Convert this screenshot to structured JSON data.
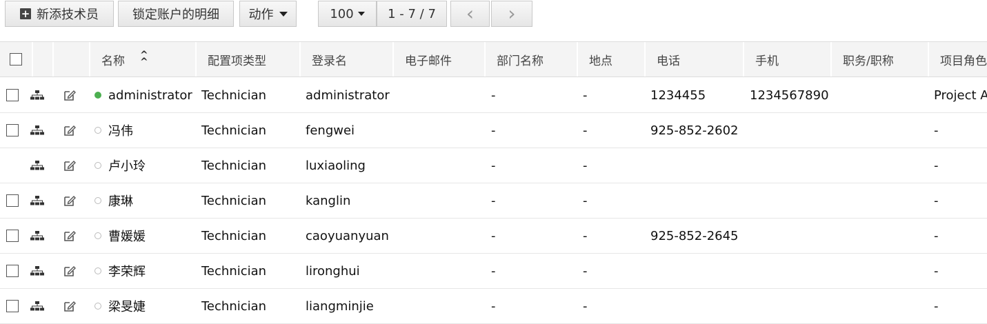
{
  "toolbar": {
    "add_technician": "新添技术员",
    "locked_accounts": "锁定账户的明细",
    "actions": "动作",
    "page_size": "100",
    "range": "1 - 7 / 7",
    "prev_icon": "chevron-left-icon",
    "next_icon": "chevron-right-icon"
  },
  "table": {
    "columns": [
      "名称",
      "配置项类型",
      "登录名",
      "电子邮件",
      "部门名称",
      "地点",
      "电话",
      "手机",
      "职务/职称",
      "项目角色"
    ],
    "rows": [
      {
        "status": "active",
        "has_checkbox": true,
        "name": "administrator",
        "type": "Technician",
        "login": "administrator",
        "email": "",
        "dept": "-",
        "site": "-",
        "phone": "1234455",
        "mobile": "1234567890",
        "title": "",
        "role": "Project A"
      },
      {
        "status": "inactive",
        "has_checkbox": true,
        "name": "冯伟",
        "type": "Technician",
        "login": "fengwei",
        "email": "",
        "dept": "-",
        "site": "-",
        "phone": "925-852-2602",
        "mobile": "",
        "title": "",
        "role": "-"
      },
      {
        "status": "inactive",
        "has_checkbox": false,
        "name": "卢小玲",
        "type": "Technician",
        "login": "luxiaoling",
        "email": "",
        "dept": "-",
        "site": "-",
        "phone": "",
        "mobile": "",
        "title": "",
        "role": "-"
      },
      {
        "status": "inactive",
        "has_checkbox": true,
        "name": "康琳",
        "type": "Technician",
        "login": "kanglin",
        "email": "",
        "dept": "-",
        "site": "-",
        "phone": "",
        "mobile": "",
        "title": "",
        "role": "-"
      },
      {
        "status": "inactive",
        "has_checkbox": true,
        "name": "曹媛媛",
        "type": "Technician",
        "login": "caoyuanyuan",
        "email": "",
        "dept": "-",
        "site": "-",
        "phone": "925-852-2645",
        "mobile": "",
        "title": "",
        "role": "-"
      },
      {
        "status": "inactive",
        "has_checkbox": true,
        "name": "李荣辉",
        "type": "Technician",
        "login": "lironghui",
        "email": "",
        "dept": "-",
        "site": "-",
        "phone": "",
        "mobile": "",
        "title": "",
        "role": "-"
      },
      {
        "status": "inactive",
        "has_checkbox": true,
        "name": "梁旻婕",
        "type": "Technician",
        "login": "liangminjie",
        "email": "",
        "dept": "-",
        "site": "-",
        "phone": "",
        "mobile": "",
        "title": "",
        "role": "-"
      }
    ]
  },
  "colors": {
    "active": "#4caf50",
    "inactive": "#bbbbbb"
  }
}
